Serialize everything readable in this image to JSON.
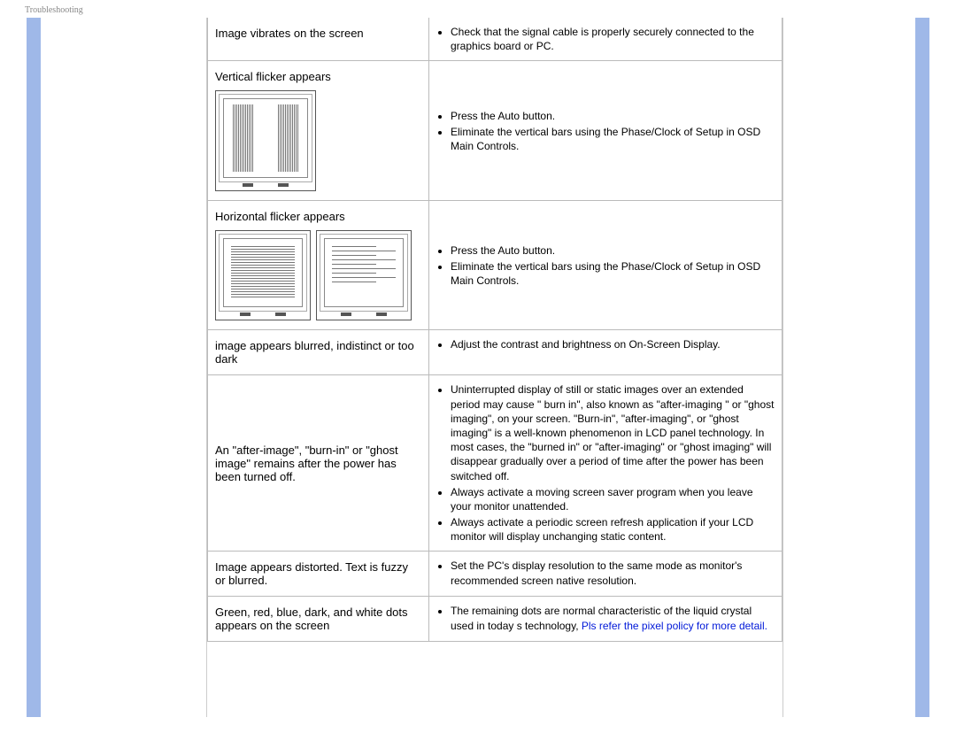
{
  "page_label": "Troubleshooting",
  "rows": [
    {
      "left": "Image vibrates on the screen",
      "items": [
        "Check that the signal cable is properly securely connected to the graphics board or PC."
      ]
    },
    {
      "left": "Vertical flicker appears",
      "illustration": "vertical",
      "items": [
        "Press the Auto button.",
        "Eliminate the vertical bars using the Phase/Clock of Setup in OSD Main Controls."
      ]
    },
    {
      "left": "Horizontal flicker appears",
      "illustration": "horizontal",
      "items": [
        "Press the Auto button.",
        "Eliminate the vertical bars using the Phase/Clock of Setup in OSD Main Controls."
      ]
    },
    {
      "left": "image appears blurred, indistinct or too dark",
      "items": [
        "Adjust the contrast and brightness on On-Screen Display."
      ]
    },
    {
      "left": "An \"after-image\", \"burn-in\" or \"ghost image\" remains after the power has been turned off.",
      "items": [
        "Uninterrupted display of still or static images over an extended period may cause \" burn in\", also known as \"after-imaging \" or \"ghost imaging\", on your screen. \"Burn-in\", \"after-imaging\", or \"ghost imaging\" is a well-known phenomenon in LCD panel technology. In most cases, the \"burned in\" or \"after-imaging\" or \"ghost imaging\" will disappear gradually over a period of time after the power has been switched off.",
        "Always activate a moving screen saver program when you leave your monitor unattended.",
        "Always activate a periodic screen refresh application if your LCD monitor will display unchanging static content."
      ]
    },
    {
      "left": "Image appears distorted. Text   is fuzzy or blurred.",
      "items": [
        "Set the PC's display resolution to the same mode as monitor's recommended screen native resolution."
      ]
    },
    {
      "left": "Green, red, blue, dark, and white dots appears on the screen",
      "items_html": [
        {
          "pre": "The remaining dots are normal characteristic of the liquid crystal used in today s technology, ",
          "link": "Pls refer the pixel policy for more detail."
        }
      ]
    }
  ]
}
